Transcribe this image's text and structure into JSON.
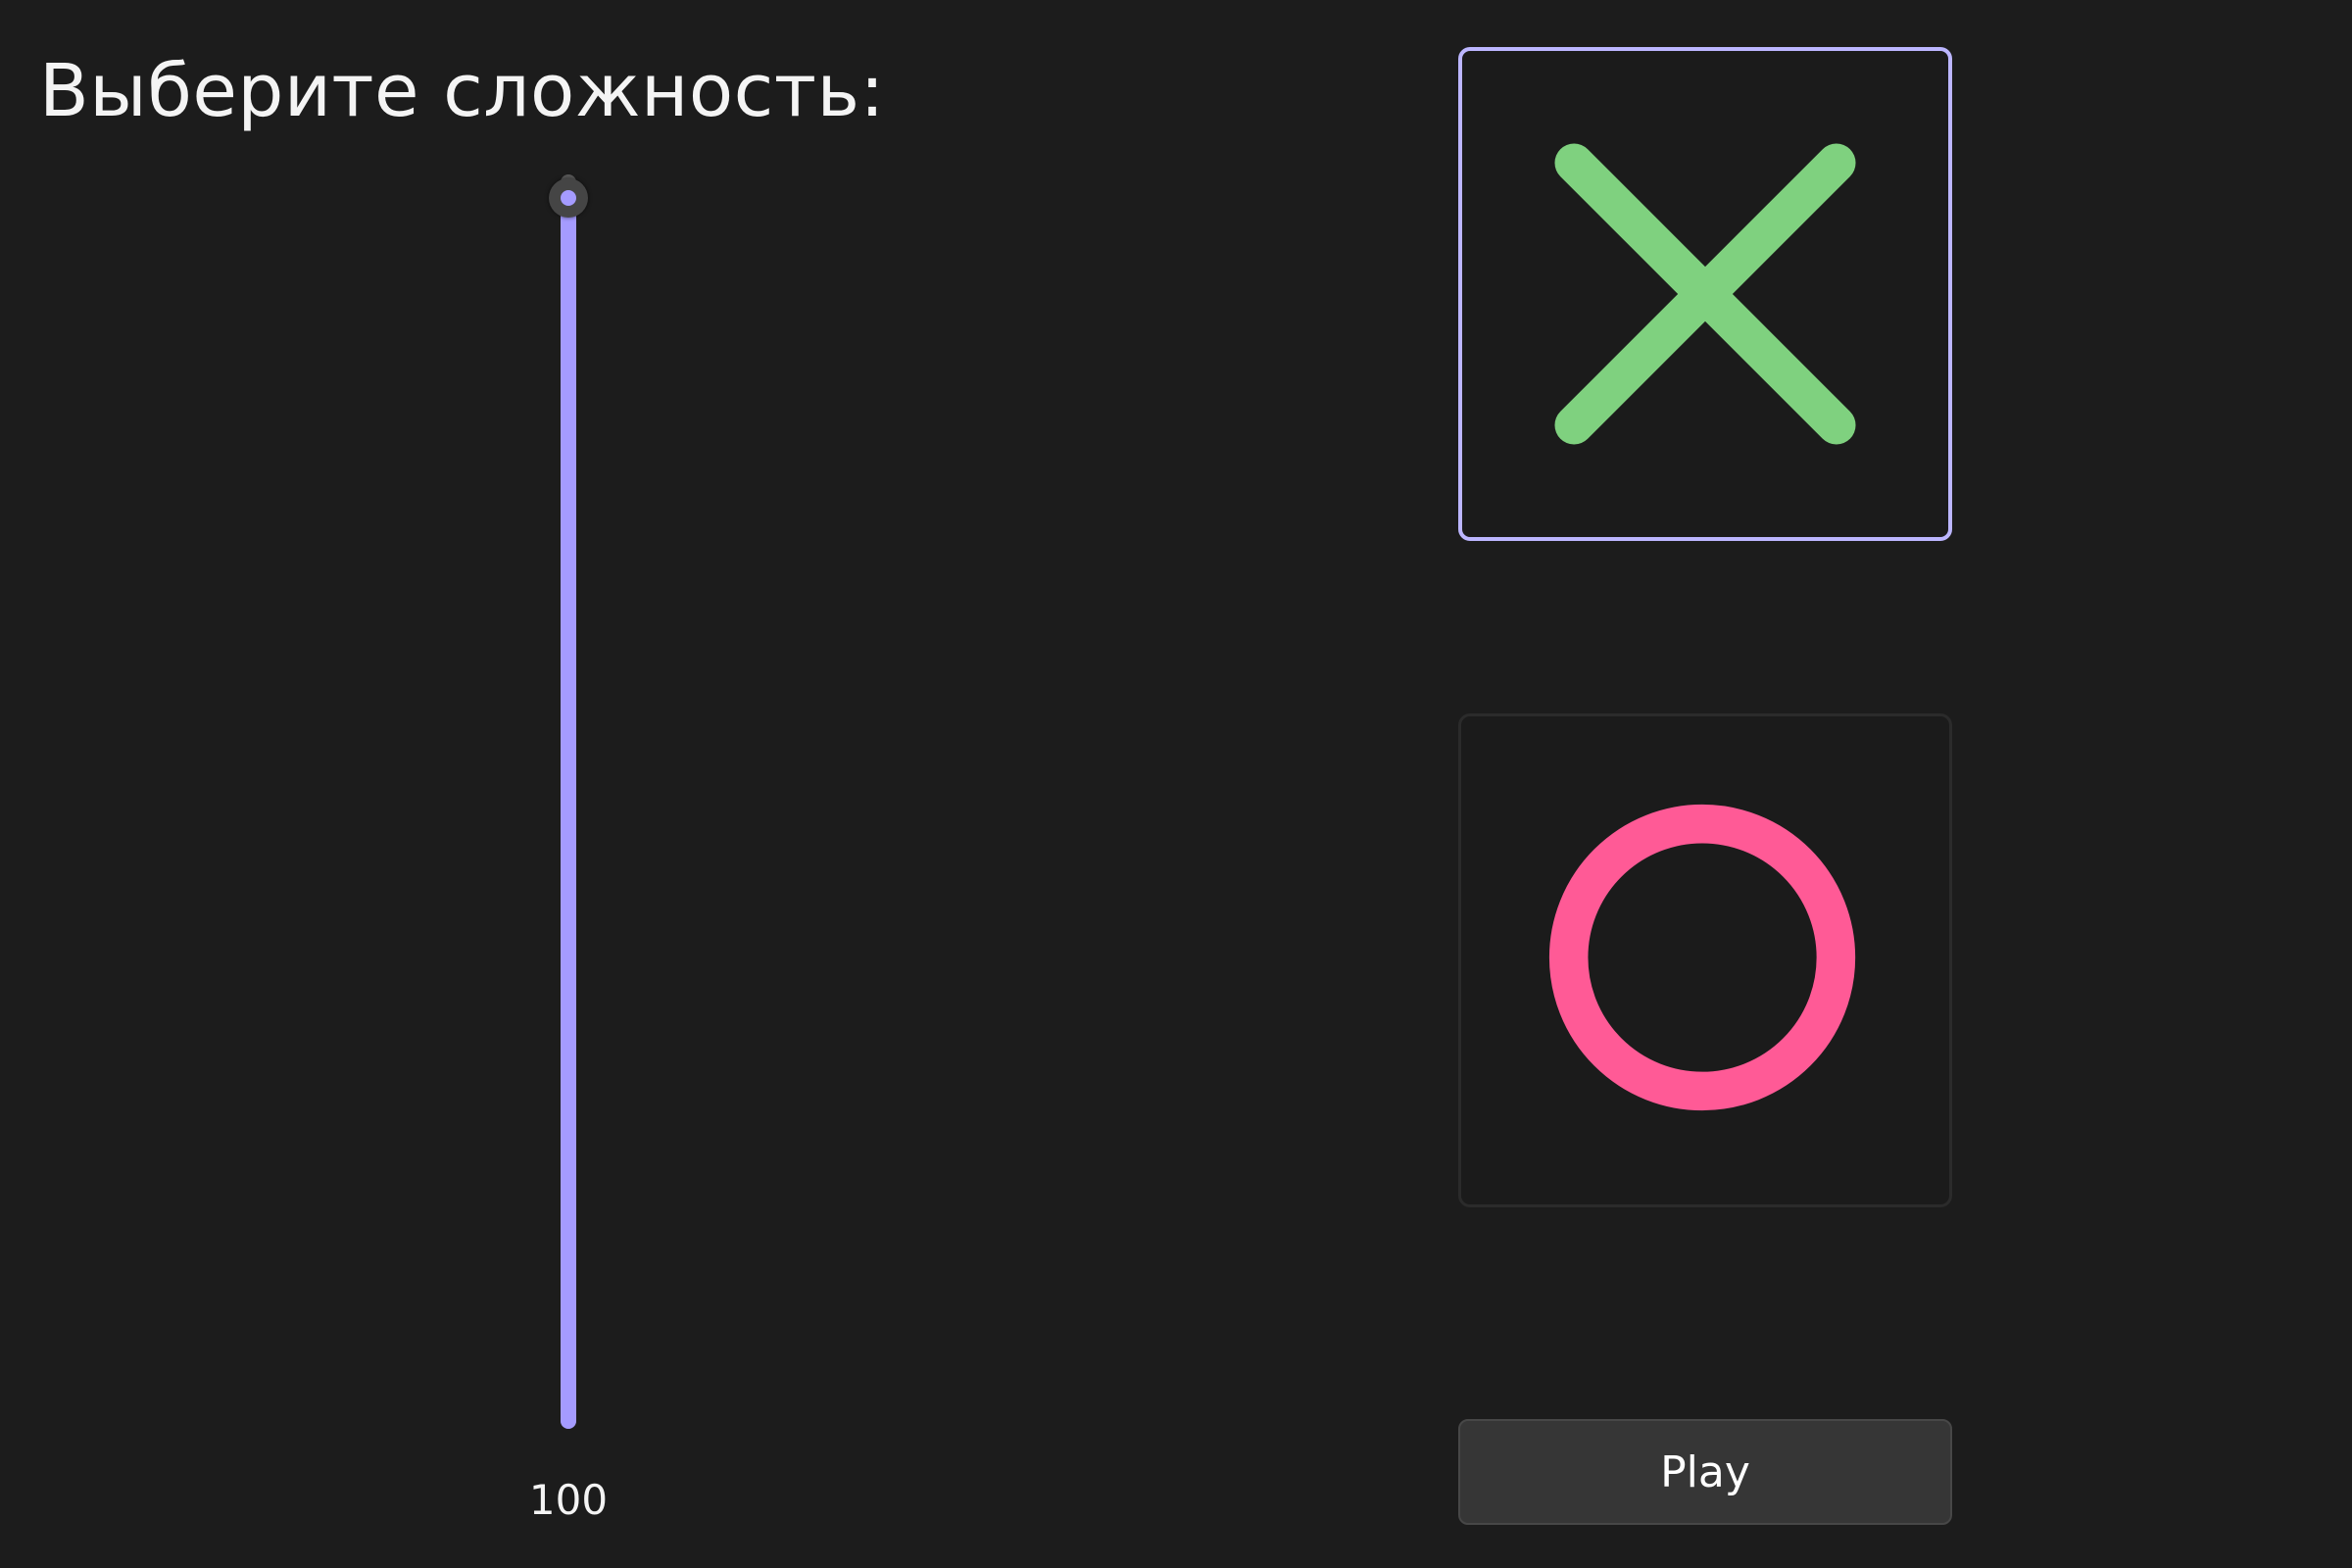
{
  "heading": "Выберите сложность:",
  "difficulty": {
    "value": "100",
    "fraction": 1.0
  },
  "choices": {
    "x": {
      "icon": "x-icon",
      "selected": true,
      "color": "#7fd17f"
    },
    "o": {
      "icon": "o-icon",
      "selected": false,
      "color": "#ff5a96"
    }
  },
  "play_label": "Play",
  "colors": {
    "background": "#1c1c1c",
    "accent": "#a59bff",
    "selected_border": "#bcb6ff"
  }
}
